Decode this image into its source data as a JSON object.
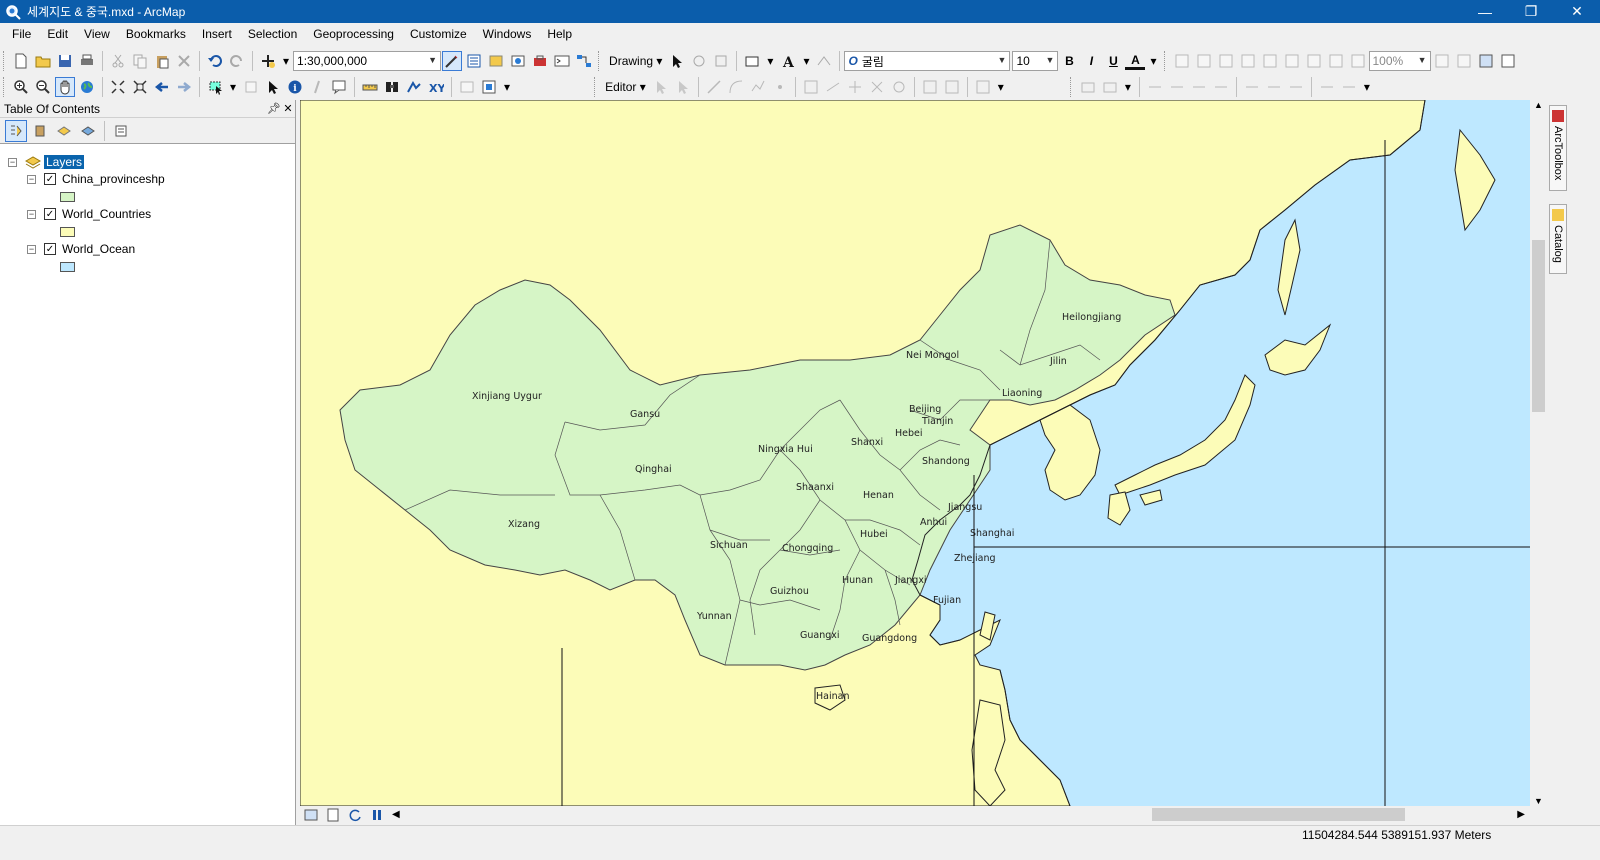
{
  "window": {
    "title": "세계지도 & 중국.mxd - ArcMap",
    "minimize": "—",
    "maximize": "❐",
    "close": "✕"
  },
  "menu": [
    "File",
    "Edit",
    "View",
    "Bookmarks",
    "Insert",
    "Selection",
    "Geoprocessing",
    "Customize",
    "Windows",
    "Help"
  ],
  "toolbar": {
    "scale": "1:30,000,000",
    "drawing_label": "Drawing",
    "font_name": "굴림",
    "font_size": "10",
    "bold": "B",
    "italic": "I",
    "underline": "U",
    "font_color_glyph": "A",
    "zoom_percent": "100%",
    "editor_label": "Editor"
  },
  "toc": {
    "title": "Table Of Contents",
    "pin": "ᛘ",
    "close": "✕",
    "root": "Layers",
    "layers": [
      {
        "name": "China_provinceshp",
        "checked": true,
        "color": "#d6f5c6"
      },
      {
        "name": "World_Countries",
        "checked": true,
        "color": "#fcfcb8"
      },
      {
        "name": "World_Ocean",
        "checked": true,
        "color": "#bee8ff"
      }
    ]
  },
  "map": {
    "land_color": "#fcfcb8",
    "china_color": "#d6f5c6",
    "ocean_color": "#bee8ff",
    "province_labels": [
      "Heilongjiang",
      "Nei Mongol",
      "Jilin",
      "Liaoning",
      "Xinjiang Uygur",
      "Beijing",
      "Tianjin",
      "Gansu",
      "Hebei",
      "Shanxi",
      "Ningxia Hui",
      "Shandong",
      "Qinghai",
      "Shaanxi",
      "Henan",
      "Jiangsu",
      "Xizang",
      "Anhui",
      "Hubei",
      "Shanghai",
      "Sichuan",
      "Chongqing",
      "Zhejiang",
      "Hunan",
      "Jiangxi",
      "Guizhou",
      "Fujian",
      "Yunnan",
      "Guangxi",
      "Guangdong",
      "Hainan"
    ]
  },
  "dock": {
    "toolbox": "ArcToolbox",
    "catalog": "Catalog"
  },
  "status": {
    "coordinates": "11504284.544  5389151.937 Meters"
  }
}
